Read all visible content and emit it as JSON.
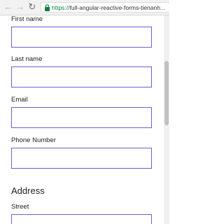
{
  "browser": {
    "url_scheme": "https://",
    "url_rest": "full-angular-reactive-forms-tienanh..."
  },
  "form": {
    "first_name_label": "First name",
    "first_name_value": "",
    "last_name_label": "Last name",
    "last_name_value": "",
    "email_label": "Email",
    "email_value": "",
    "phone_label": "Phone Number",
    "phone_value": "",
    "address_heading": "Address",
    "street_label": "Street",
    "street_value": ""
  },
  "colors": {
    "input_border": "#6b5fd3",
    "secure_lock": "#0b8043"
  }
}
